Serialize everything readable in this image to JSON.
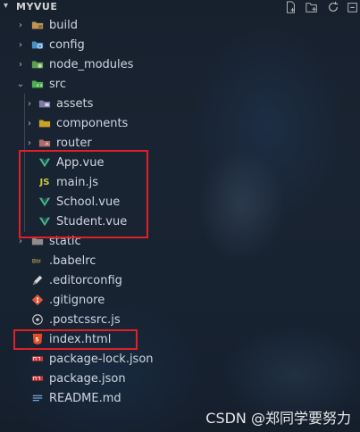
{
  "explorer": {
    "root_label": "MYVUE",
    "toolbar": [
      "new-file-icon",
      "new-folder-icon",
      "refresh-icon",
      "collapse-all-icon"
    ]
  },
  "tree": {
    "build": "build",
    "config": "config",
    "node_modules": "node_modules",
    "src": "src",
    "assets": "assets",
    "components": "components",
    "router": "router",
    "app_vue": "App.vue",
    "main_js": "main.js",
    "school_vue": "School.vue",
    "student_vue": "Student.vue",
    "static": "static",
    "babelrc": ".babelrc",
    "editorconfig": ".editorconfig",
    "gitignore": ".gitignore",
    "postcssrc": ".postcssrc.js",
    "index_html": "index.html",
    "package_lock": "package-lock.json",
    "package_json": "package.json",
    "readme": "README.md"
  },
  "icons": {
    "js_badge": "JS"
  },
  "colors": {
    "highlight_box": "#e21f26",
    "vue_green": "#42b883",
    "js_yellow": "#cbcb41"
  },
  "watermark": "CSDN @郑同学要努力"
}
